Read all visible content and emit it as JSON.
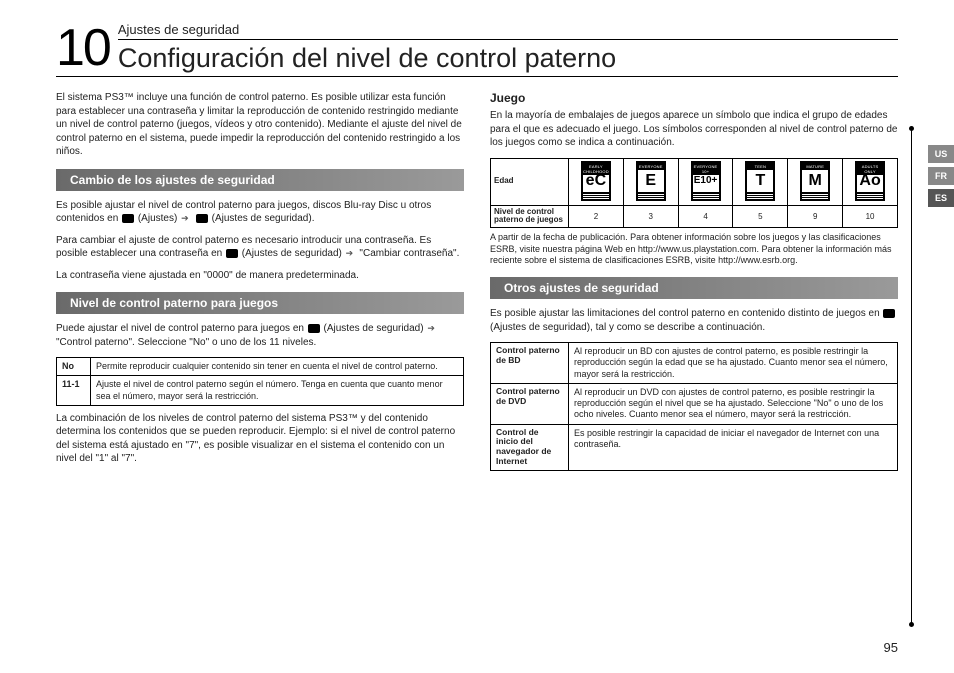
{
  "header": {
    "chapter_number": "10",
    "overline": "Ajustes de seguridad",
    "title": "Configuración del nivel de control paterno"
  },
  "intro": "El sistema PS3™ incluye una función de control paterno. Es posible utilizar esta función para establecer una contraseña y limitar la reproducción de contenido restringido mediante un nivel de control paterno (juegos, vídeos y otro contenido). Mediante el ajuste del nivel de control paterno en el sistema, puede impedir la reproducción del contenido restringido a los niños.",
  "sec1": {
    "bar": "Cambio de los ajustes de seguridad",
    "p1a": "Es posible ajustar el nivel de control paterno para juegos, discos Blu-ray Disc u otros contenidos en ",
    "p1b": " (Ajustes) ",
    "p1c": " (Ajustes de seguridad).",
    "p2a": "Para cambiar el ajuste de control paterno es necesario introducir una contraseña. Es posible establecer una contraseña en ",
    "p2b": " (Ajustes de seguridad) ",
    "p2c": " \"Cambiar contraseña\".",
    "p3": "La contraseña viene ajustada en \"0000\" de manera predeterminada."
  },
  "sec2": {
    "bar": "Nivel de control paterno para juegos",
    "p1a": "Puede ajustar el nivel de control paterno para juegos en ",
    "p1b": " (Ajustes de seguridad) ",
    "p1c": " \"Control paterno\". Seleccione \"No\" o uno de los 11 niveles.",
    "table": {
      "r1": {
        "label": "No",
        "text": "Permite reproducir cualquier contenido sin tener en cuenta el nivel de control paterno."
      },
      "r2": {
        "label": "11-1",
        "text": "Ajuste el nivel de control paterno según el número. Tenga en cuenta que cuanto menor sea el número, mayor será la restricción."
      }
    },
    "p2": "La combinación de los niveles de control paterno del sistema PS3™ y del contenido determina los contenidos que se pueden reproducir. Ejemplo: si el nivel de control paterno del sistema está ajustado en \"7\", es posible visualizar en el sistema el contenido con un nivel del \"1\" al \"7\"."
  },
  "sec3": {
    "heading": "Juego",
    "p1": "En la mayoría de embalajes de juegos aparece un símbolo que indica el grupo de edades para el que es adecuado el juego. Los símbolos corresponden al nivel de control paterno de los juegos como se indica a continuación.",
    "table": {
      "row1_label": "Edad",
      "row2_label": "Nivel de control paterno de juegos",
      "cols": [
        {
          "letter": "eC",
          "top": "EARLY CHILDHOOD",
          "level": "2"
        },
        {
          "letter": "E",
          "top": "EVERYONE",
          "level": "3"
        },
        {
          "letter": "E10+",
          "top": "EVERYONE 10+",
          "level": "4"
        },
        {
          "letter": "T",
          "top": "TEEN",
          "level": "5"
        },
        {
          "letter": "M",
          "top": "MATURE",
          "level": "9"
        },
        {
          "letter": "Ao",
          "top": "ADULTS ONLY",
          "level": "10"
        }
      ]
    },
    "footnote": "A partir de la fecha de publicación. Para obtener información sobre los juegos y las clasificaciones ESRB, visite nuestra página Web en http://www.us.playstation.com. Para obtener la información más reciente sobre el sistema de clasificaciones ESRB, visite http://www.esrb.org."
  },
  "sec4": {
    "bar": "Otros ajustes de seguridad",
    "p1a": "Es posible ajustar las limitaciones del control paterno en contenido distinto de juegos en ",
    "p1b": " (Ajustes de seguridad), tal y como se describe a continuación.",
    "table": {
      "r1": {
        "label": "Control paterno de BD",
        "text": "Al reproducir un BD con ajustes de control paterno, es posible restringir la reproducción según la edad que se ha ajustado. Cuanto menor sea el número, mayor será la restricción."
      },
      "r2": {
        "label": "Control paterno de DVD",
        "text": "Al reproducir un DVD con ajustes de control paterno, es posible restringir la reproducción según el nivel que se ha ajustado. Seleccione \"No\" o uno de los ocho niveles. Cuanto menor sea el número, mayor será la restricción."
      },
      "r3": {
        "label": "Control de inicio del navegador de Internet",
        "text": "Es posible restringir la capacidad de iniciar el navegador de Internet con una contraseña."
      }
    }
  },
  "lang_tabs": {
    "us": "US",
    "fr": "FR",
    "es": "ES"
  },
  "page_number": "95"
}
